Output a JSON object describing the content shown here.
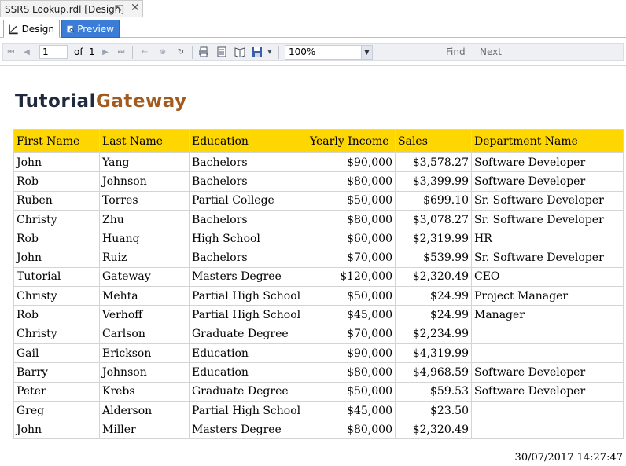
{
  "document_tab": {
    "title": "SSRS Lookup.rdl [Design]",
    "pin_icon": "pin-icon",
    "close_icon": "close-icon"
  },
  "view_tabs": [
    {
      "label": "Design",
      "icon": "design-ruler-icon",
      "active": false
    },
    {
      "label": "Preview",
      "icon": "preview-icon",
      "active": true
    }
  ],
  "toolbar": {
    "page_current": "1",
    "of_label": "of",
    "page_total": "1",
    "zoom": "100%",
    "find_label": "Find",
    "next_label": "Next"
  },
  "report": {
    "logo_part1": "Tutorial",
    "logo_part2": "Gateway",
    "columns": [
      "First Name",
      "Last Name",
      "Education",
      "Yearly Income",
      "Sales",
      "Department Name"
    ],
    "rows": [
      [
        "John",
        "Yang",
        "Bachelors",
        "$90,000",
        "$3,578.27",
        "Software Developer"
      ],
      [
        "Rob",
        "Johnson",
        "Bachelors",
        "$80,000",
        "$3,399.99",
        "Software Developer"
      ],
      [
        "Ruben",
        "Torres",
        "Partial College",
        "$50,000",
        "$699.10",
        "Sr. Software Developer"
      ],
      [
        "Christy",
        "Zhu",
        "Bachelors",
        "$80,000",
        "$3,078.27",
        "Sr. Software Developer"
      ],
      [
        "Rob",
        "Huang",
        "High School",
        "$60,000",
        "$2,319.99",
        "HR"
      ],
      [
        "John",
        "Ruiz",
        "Bachelors",
        "$70,000",
        "$539.99",
        "Sr. Software Developer"
      ],
      [
        "Tutorial",
        "Gateway",
        "Masters Degree",
        "$120,000",
        "$2,320.49",
        "CEO"
      ],
      [
        "Christy",
        "Mehta",
        "Partial High School",
        "$50,000",
        "$24.99",
        "Project Manager"
      ],
      [
        "Rob",
        "Verhoff",
        "Partial High School",
        "$45,000",
        "$24.99",
        "Manager"
      ],
      [
        "Christy",
        "Carlson",
        "Graduate Degree",
        "$70,000",
        "$2,234.99",
        ""
      ],
      [
        "Gail",
        "Erickson",
        "Education",
        "$90,000",
        "$4,319.99",
        ""
      ],
      [
        "Barry",
        "Johnson",
        "Education",
        "$80,000",
        "$4,968.59",
        "Software Developer"
      ],
      [
        "Peter",
        "Krebs",
        "Graduate Degree",
        "$50,000",
        "$59.53",
        "Software Developer"
      ],
      [
        "Greg",
        "Alderson",
        "Partial High School",
        "$45,000",
        "$23.50",
        ""
      ],
      [
        "John",
        "Miller",
        "Masters Degree",
        "$80,000",
        "$2,320.49",
        ""
      ]
    ],
    "timestamp": "30/07/2017 14:27:47"
  },
  "colors": {
    "header_fill": "#ffd700",
    "logo_dark": "#1f2a3c",
    "logo_accent": "#a35a1e",
    "preview_tab": "#3b7cd6"
  }
}
